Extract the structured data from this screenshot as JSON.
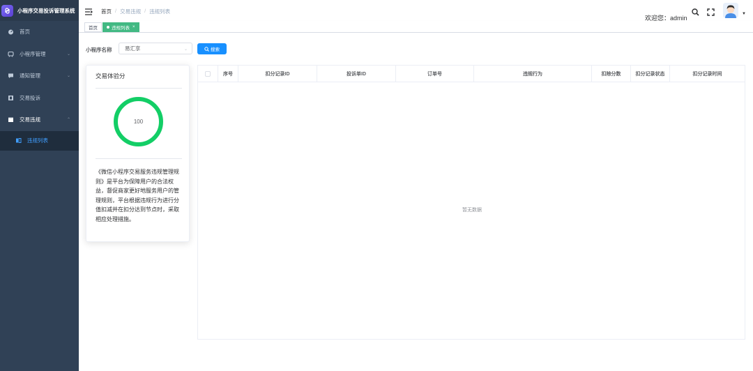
{
  "app": {
    "title": "小程序交易投诉管理系统"
  },
  "sidebar": {
    "items": [
      {
        "label": "首页",
        "icon": "dashboard-icon",
        "has_children": false
      },
      {
        "label": "小程序管理",
        "icon": "miniapp-icon",
        "has_children": true
      },
      {
        "label": "通知管理",
        "icon": "message-icon",
        "has_children": true
      },
      {
        "label": "交易投诉",
        "icon": "complaint-icon",
        "has_children": false
      },
      {
        "label": "交易违规",
        "icon": "violation-icon",
        "has_children": true
      }
    ],
    "active_submenu": {
      "label": "违规列表",
      "icon": "list-icon"
    }
  },
  "header": {
    "breadcrumb": [
      "首页",
      "交易违规",
      "违规列表"
    ],
    "welcome": "欢迎您：admin"
  },
  "tags": [
    {
      "label": "首页",
      "active": false
    },
    {
      "label": "违规列表",
      "active": true
    }
  ],
  "search": {
    "label": "小程序名称",
    "selected": "易汇享",
    "button_label": "搜索"
  },
  "score_card": {
    "title": "交易体验分",
    "score": "100",
    "description": "《微信小程序交易服务违规管理规则》是平台为保障用户的合法权益，督促商家更好地服务用户的管理规则，平台根据违规行为进行分值扣减并在扣分达到节点时，采取相应处理措施。"
  },
  "table": {
    "columns": [
      "序号",
      "扣分记录ID",
      "投诉单ID",
      "订单号",
      "违规行为",
      "扣除分数",
      "扣分记录状态",
      "扣分记录时间"
    ],
    "rows": [],
    "empty_text": "暂无数据"
  },
  "colors": {
    "sidebar_bg": "#304156",
    "accent": "#409eff",
    "active_tag": "#42b983",
    "gauge": "#13ce66",
    "search_button": "#1890ff"
  }
}
